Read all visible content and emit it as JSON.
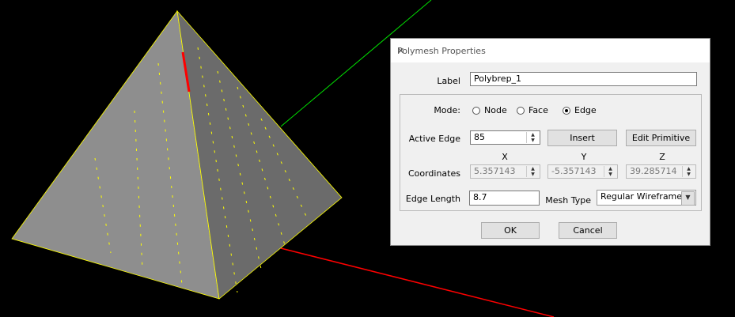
{
  "dialog": {
    "title": "Polymesh Properties",
    "label_caption": "Label",
    "label_value": "Polybrep_1",
    "mode_caption": "Mode:",
    "modes": [
      {
        "label": "Node",
        "selected": false
      },
      {
        "label": "Face",
        "selected": false
      },
      {
        "label": "Edge",
        "selected": true
      }
    ],
    "active_edge_caption": "Active Edge",
    "active_edge_value": "85",
    "insert_label": "Insert",
    "edit_primitive_label": "Edit Primitive",
    "axis_x": "X",
    "axis_y": "Y",
    "axis_z": "Z",
    "coordinates_caption": "Coordinates",
    "coord_x": "5.357143",
    "coord_y": "-5.357143",
    "coord_z": "39.285714",
    "edge_length_caption": "Edge Length",
    "edge_length_value": "8.7",
    "mesh_type_caption": "Mesh Type",
    "mesh_type_value": "Regular Wireframe",
    "ok_label": "OK",
    "cancel_label": "Cancel"
  },
  "colors": {
    "x_axis": "#ff0000",
    "y_axis": "#00ff00",
    "wire": "#ffff00"
  }
}
